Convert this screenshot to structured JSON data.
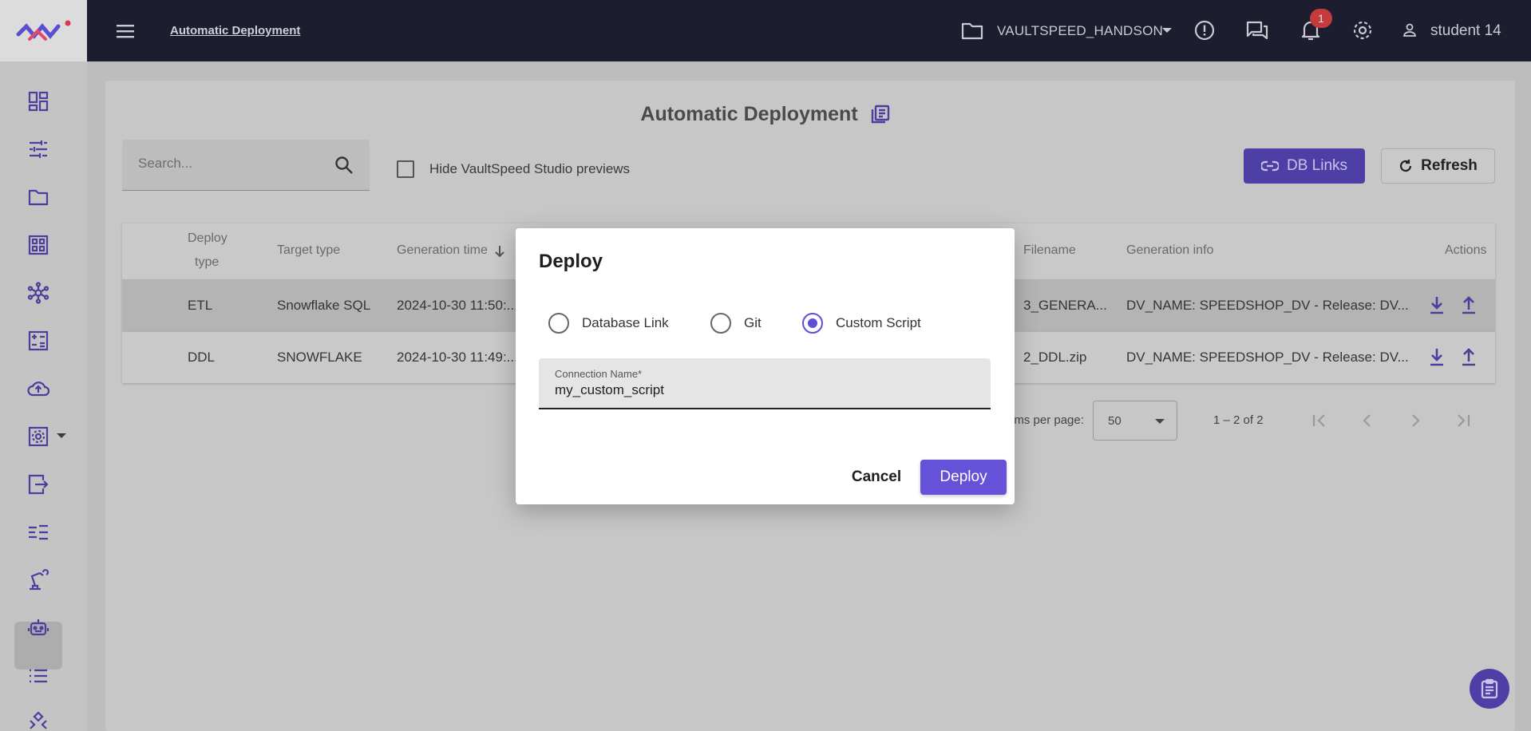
{
  "header": {
    "app_title": "Automatic Deployment",
    "project_name": "VAULTSPEED_HANDSON",
    "notification_count": "1",
    "user_name": "student 14"
  },
  "sidebar": {
    "items": [
      "dashboard-icon",
      "tune-icon",
      "folder-icon",
      "grid-icon",
      "hub-icon",
      "calculator-icon",
      "cloud-upload-icon",
      "settings-box-icon",
      "export-icon",
      "list-check-icon",
      "robot-arm-icon",
      "robot-icon",
      "list-icon",
      "network-icon"
    ],
    "active_index": 10
  },
  "page": {
    "title": "Automatic Deployment",
    "search_placeholder": "Search...",
    "hide_previews_label": "Hide VaultSpeed Studio previews",
    "db_links_label": "DB Links",
    "refresh_label": "Refresh"
  },
  "table": {
    "headers": {
      "deploy_type_1": "Deploy",
      "deploy_type_2": "type",
      "target_type": "Target type",
      "generation_time": "Generation time",
      "filename": "Filename",
      "generation_info": "Generation info",
      "actions": "Actions"
    },
    "rows": [
      {
        "deploy_type": "ETL",
        "target_type": "Snowflake SQL",
        "generation_time": "2024-10-30 11:50:...",
        "filename": "3_GENERA...",
        "generation_info": "DV_NAME: SPEEDSHOP_DV - Release: DV..."
      },
      {
        "deploy_type": "DDL",
        "target_type": "SNOWFLAKE",
        "generation_time": "2024-10-30 11:49:...",
        "filename": "2_DDL.zip",
        "generation_info": "DV_NAME: SPEEDSHOP_DV - Release: DV..."
      }
    ]
  },
  "paginator": {
    "items_per_page_label": "ems per page:",
    "page_size": "50",
    "range": "1 – 2 of 2"
  },
  "modal": {
    "title": "Deploy",
    "options": [
      "Database Link",
      "Git",
      "Custom Script"
    ],
    "selected_option": "Custom Script",
    "field_label": "Connection Name*",
    "field_value": "my_custom_script",
    "cancel_label": "Cancel",
    "deploy_label": "Deploy"
  },
  "colors": {
    "topbar": "#1c1d2e",
    "accent": "#5b4fd6",
    "badge": "#c53a3a"
  }
}
